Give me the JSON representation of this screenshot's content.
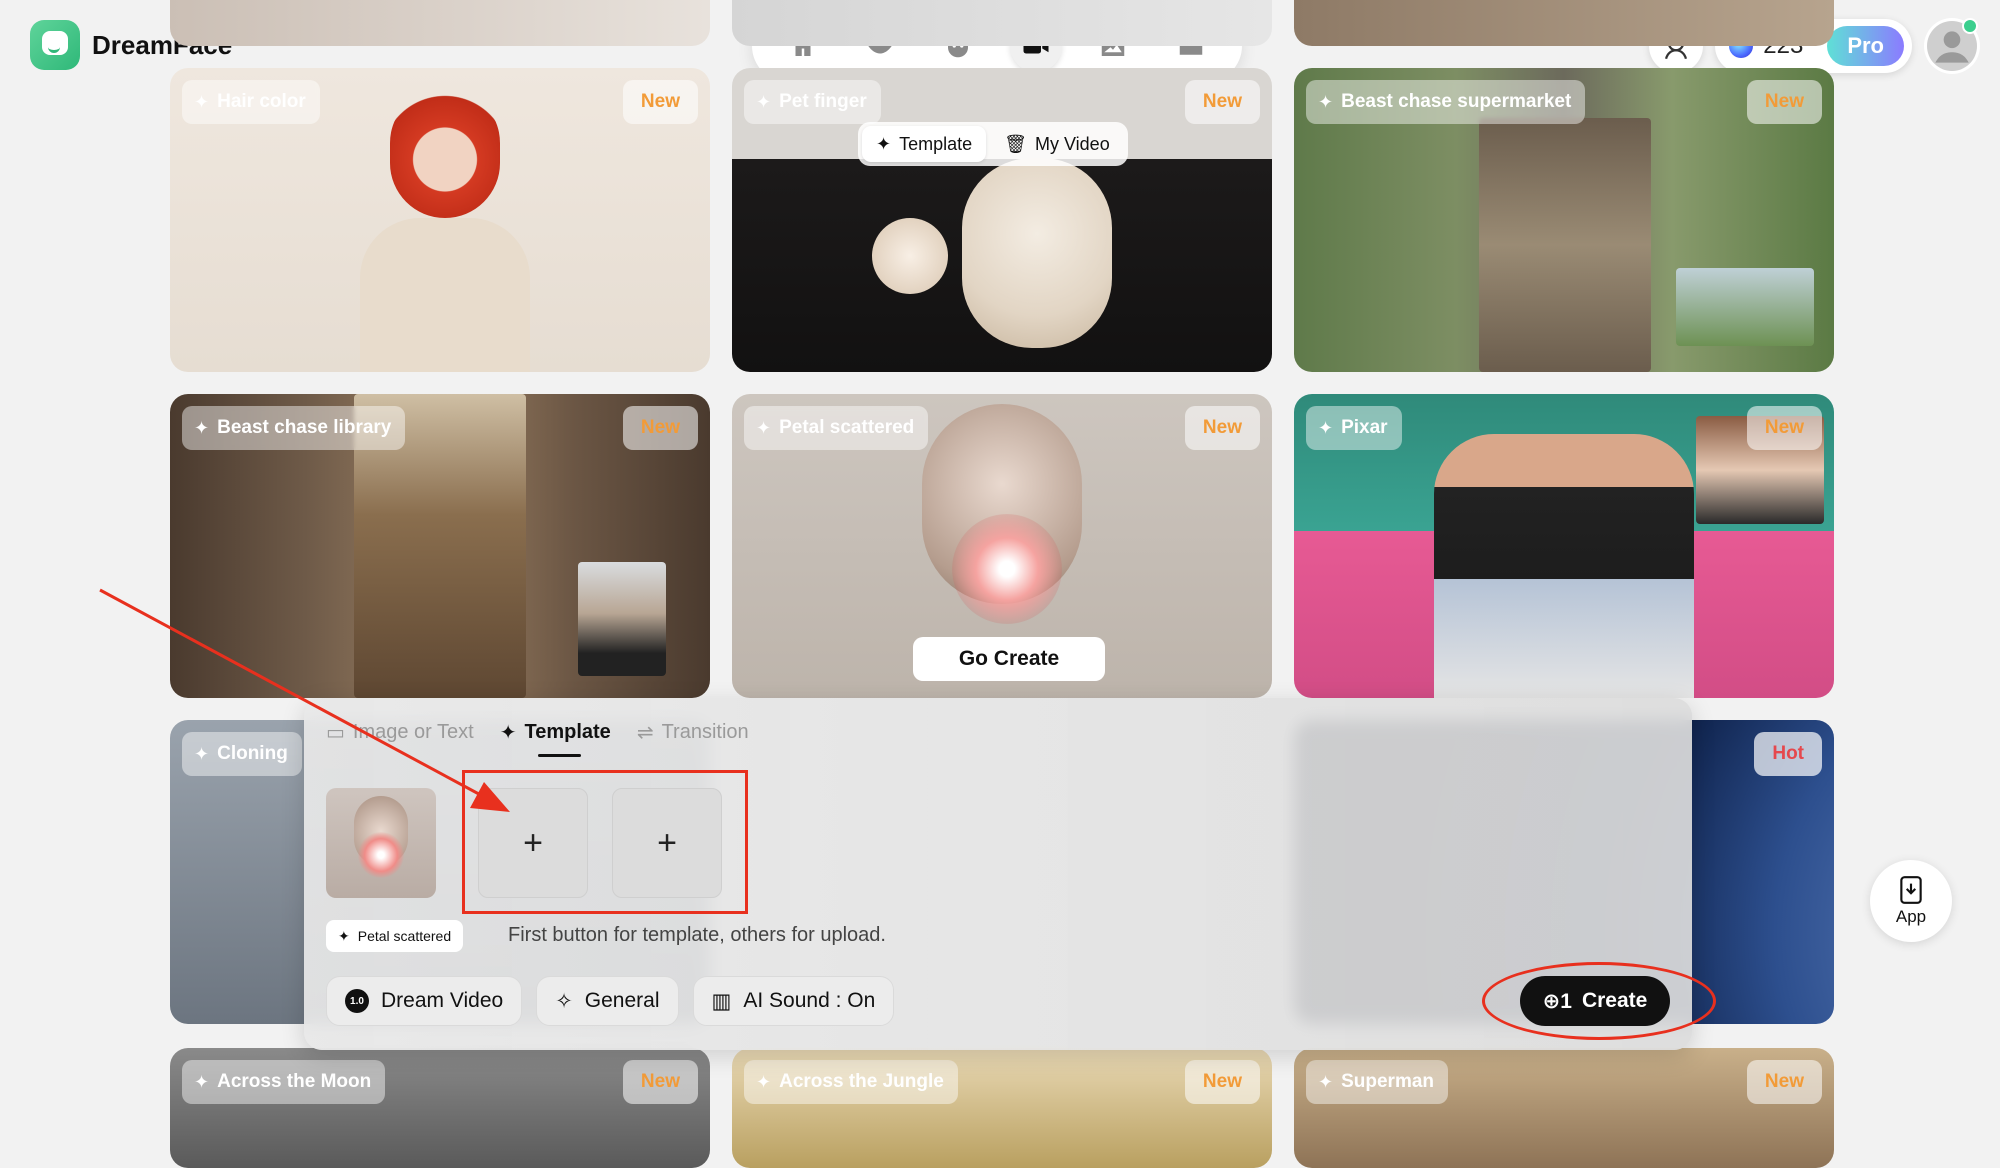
{
  "app": {
    "name": "DreamFace"
  },
  "nav": {
    "items": [
      "home-icon",
      "lips-icon",
      "cat-icon",
      "video-camera-icon",
      "image-icon",
      "folder-icon"
    ],
    "active_index": 3
  },
  "header": {
    "credits": "223",
    "pro_label": "Pro"
  },
  "cards": {
    "row0": [
      {
        "label": ""
      },
      {
        "label": ""
      },
      {
        "label": ""
      }
    ],
    "hair_color": {
      "label": "Hair color",
      "badge": "New"
    },
    "pet_finger": {
      "label": "Pet finger",
      "badge": "New"
    },
    "beast_supermarket": {
      "label": "Beast chase supermarket",
      "badge": "New"
    },
    "beast_library": {
      "label": "Beast chase library",
      "badge": "New"
    },
    "petal_scattered": {
      "label": "Petal scattered",
      "badge": "New",
      "cta": "Go Create"
    },
    "pixar": {
      "label": "Pixar",
      "badge": "New"
    },
    "cloning": {
      "label": "Cloning"
    },
    "space": {
      "badge": "Hot"
    },
    "across_moon": {
      "label": "Across the Moon",
      "badge": "New"
    },
    "across_jungle": {
      "label": "Across the Jungle",
      "badge": "New"
    },
    "superman": {
      "label": "Superman",
      "badge": "New"
    }
  },
  "segment": {
    "template": "Template",
    "my_video": "My Video"
  },
  "panel": {
    "tabs": [
      "Image or Text",
      "Template",
      "Transition"
    ],
    "active_tab": 1,
    "template_name": "Petal scattered",
    "hint": "First button for template, others for upload.",
    "upload_symbol": "+",
    "options": {
      "model": "Dream Video",
      "model_version": "1.0",
      "style": "General",
      "sound": "AI Sound : On"
    },
    "create_label": "Create",
    "create_cost": "1"
  },
  "app_button": {
    "label": "App"
  },
  "colors": {
    "accent_new": "#f29b38",
    "accent_hot": "#e5484d",
    "annotation": "#e8301e"
  }
}
